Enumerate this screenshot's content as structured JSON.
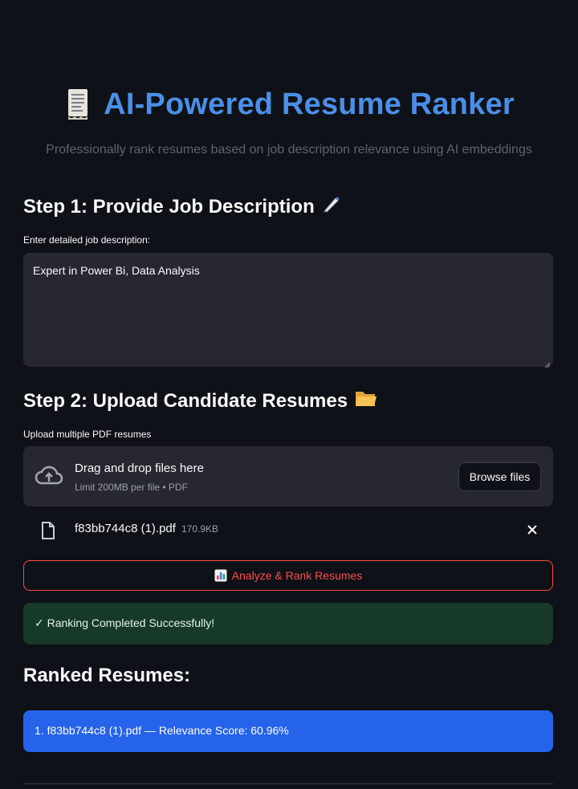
{
  "header": {
    "icon": "receipt-scroll-icon",
    "title": "AI-Powered Resume Ranker",
    "subtitle": "Professionally rank resumes based on job description relevance using AI embeddings"
  },
  "step1": {
    "heading": "Step 1: Provide Job Description",
    "heading_icon": "pen-icon",
    "label": "Enter detailed job description:",
    "value": "Expert in Power Bi, Data Analysis"
  },
  "step2": {
    "heading": "Step 2: Upload Candidate Resumes",
    "heading_icon": "folder-icon",
    "label": "Upload multiple PDF resumes",
    "dropzone": {
      "title": "Drag and drop files here",
      "subtitle": "Limit 200MB per file • PDF",
      "browse_label": "Browse files"
    },
    "files": [
      {
        "name": "f83bb744c8 (1).pdf",
        "size": "170.9KB"
      }
    ]
  },
  "actions": {
    "analyze_label": "Analyze & Rank Resumes",
    "analyze_icon": "bar-chart-icon"
  },
  "status": {
    "success_text": "✓ Ranking Completed Successfully!"
  },
  "results": {
    "heading": "Ranked Resumes:",
    "items": [
      {
        "text": "1. f83bb744c8 (1).pdf — Relevance Score: 60.96%"
      }
    ]
  },
  "colors": {
    "background": "#0e1117",
    "title_blue": "#4a8fe7",
    "accent_red": "#ff4b4b",
    "success_bg": "#173928",
    "result_bg": "#2563eb"
  }
}
